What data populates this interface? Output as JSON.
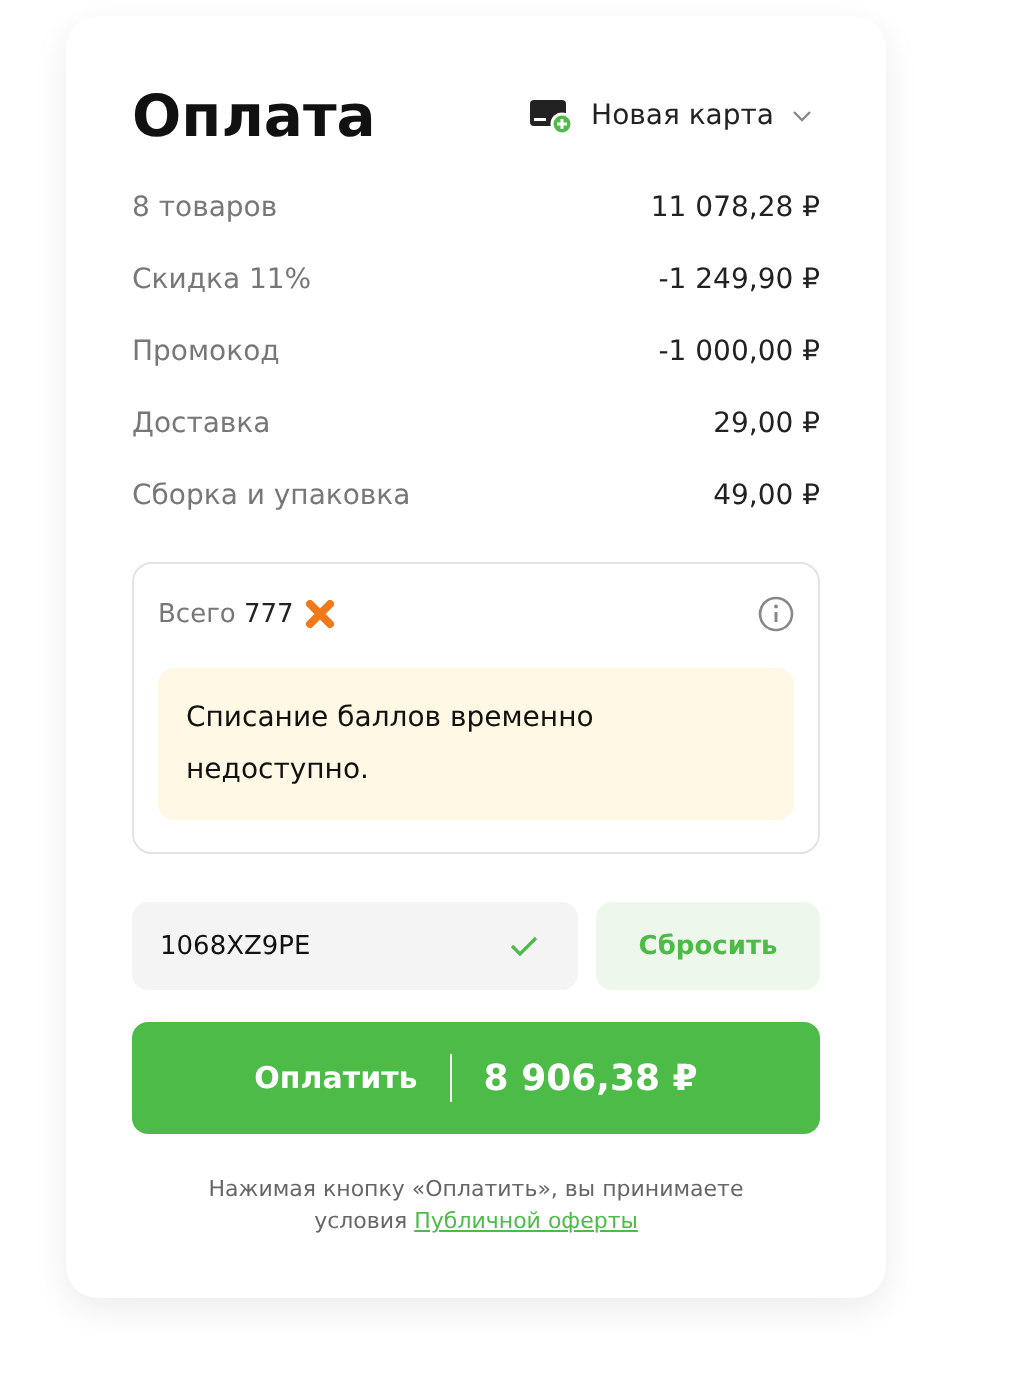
{
  "title": "Оплата",
  "card_selector": {
    "label": "Новая карта"
  },
  "summary": [
    {
      "label": "8 товаров",
      "value": "11 078,28 ₽"
    },
    {
      "label": "Скидка 11%",
      "value": "-1 249,90 ₽"
    },
    {
      "label": "Промокод",
      "value": "-1 000,00 ₽"
    },
    {
      "label": "Доставка",
      "value": "29,00 ₽"
    },
    {
      "label": "Сборка и упаковка",
      "value": "49,00 ₽"
    }
  ],
  "points": {
    "label": "Всего",
    "amount": "777",
    "notice": "Списание баллов временно недоступно."
  },
  "promo": {
    "value": "1068XZ9PE",
    "valid": true,
    "reset_button": "Сбросить"
  },
  "pay_button": {
    "label": "Оплатить",
    "amount": "8 906,38 ₽"
  },
  "legal": {
    "text": "Нажимая кнопку «Оплатить», вы принимаете условия",
    "link": "Публичной оферты"
  }
}
